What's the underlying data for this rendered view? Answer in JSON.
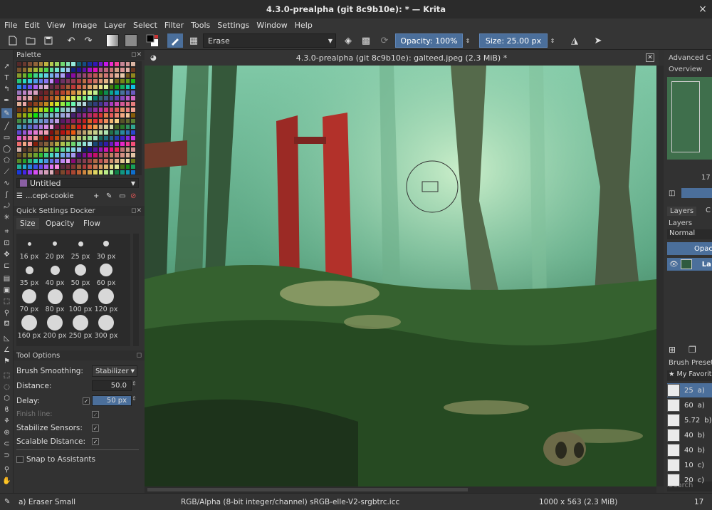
{
  "window": {
    "title": "4.3.0-prealpha (git 8c9b10e):  * — Krita",
    "close_label": "×"
  },
  "menu": [
    "File",
    "Edit",
    "View",
    "Image",
    "Layer",
    "Select",
    "Filter",
    "Tools",
    "Settings",
    "Window",
    "Help"
  ],
  "toolbar": {
    "blend_mode": "Erase",
    "opacity": "Opacity: 100%",
    "size": "Size: 25.00 px"
  },
  "palette": {
    "title": "Palette",
    "name": "Untitled",
    "palette_label": "...cept-cookie"
  },
  "quick_settings": {
    "title": "Quick Settings Docker",
    "tabs": [
      "Size",
      "Opacity",
      "Flow"
    ],
    "sizes": [
      "16 px",
      "20 px",
      "25 px",
      "30 px",
      "35 px",
      "40 px",
      "50 px",
      "60 px",
      "70 px",
      "80 px",
      "100 px",
      "120 px",
      "160 px",
      "200 px",
      "250 px",
      "300 px"
    ]
  },
  "tool_options": {
    "title": "Tool Options",
    "brush_smoothing_label": "Brush Smoothing:",
    "brush_smoothing_value": "Stabilizer",
    "distance_label": "Distance:",
    "distance_value": "50.0",
    "delay_label": "Delay:",
    "delay_value": "50 px",
    "finish_line_label": "Finish line:",
    "stabilize_sensors_label": "Stabilize Sensors:",
    "scalable_distance_label": "Scalable Distance:",
    "snap_label": "Snap to Assistants",
    "check_mark": "✓"
  },
  "document": {
    "tab_title": "4.3.0-prealpha (git 8c9b10e): galteed.jpeg (2.3 MiB) *"
  },
  "right_dock": {
    "advanced_color": "Advanced C",
    "overview": "Overview",
    "zoom_value": "17",
    "layers_tab": "Layers",
    "layers_tab2": "C",
    "layers_label": "Layers",
    "blend": "Normal",
    "opacity_btn": "Opac",
    "layer_name": "La",
    "brush_presets": "Brush Presets",
    "favorites": "★ My Favorit",
    "presets": [
      "25",
      "60",
      "5.72",
      "40",
      "40",
      "10",
      "20"
    ],
    "preset_letters": [
      "a)",
      "a)",
      "b)",
      "b)",
      "b)",
      "c)",
      "c)"
    ],
    "search_placeholder": "Search"
  },
  "status": {
    "brush": "a) Eraser Small",
    "color_space": "RGB/Alpha (8-bit integer/channel)  sRGB-elle-V2-srgbtrc.icc",
    "dimensions": "1000 x 563 (2.3 MiB)",
    "zoom": "17"
  }
}
